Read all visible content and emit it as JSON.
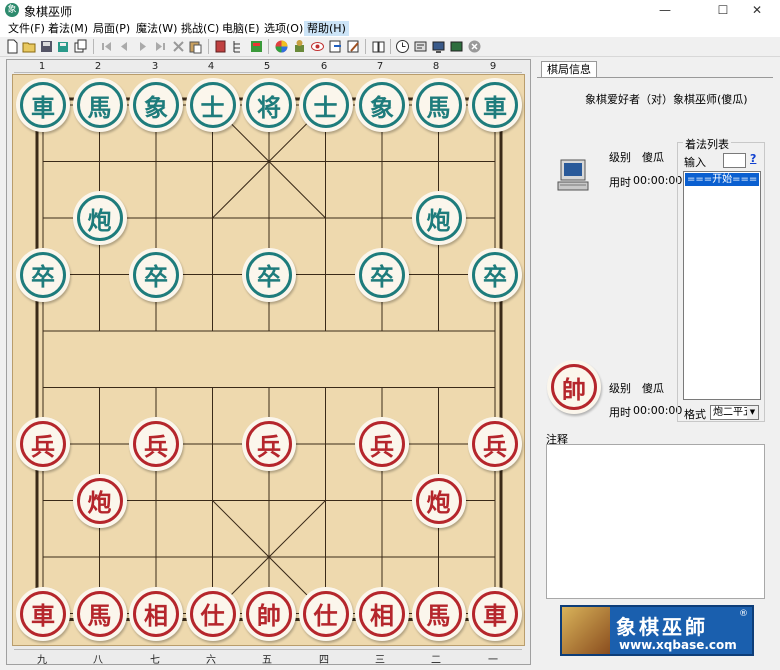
{
  "window": {
    "title": "象棋巫师",
    "app_icon_char": "象",
    "controls": [
      "—",
      "☐",
      "✕"
    ]
  },
  "menu": [
    "文件(F)",
    "着法(M)",
    "局面(P)",
    "魔法(W)",
    "挑战(C)",
    "电脑(E)",
    "选项(O)",
    "帮助(H)"
  ],
  "active_menu_index": 7,
  "toolbar_icons": [
    "new-file-icon",
    "open-folder-icon",
    "save-icon",
    "save-as-icon",
    "copy-board-icon",
    "first-move-icon",
    "prev-move-icon",
    "next-move-icon",
    "last-move-icon",
    "delete-icon",
    "paste-icon",
    "book-icon",
    "tree-icon",
    "calculator-icon",
    "color-wheel-icon",
    "engine-icon",
    "eye-icon",
    "export-icon",
    "edit-icon",
    "manual-icon",
    "clock-icon",
    "settings-icon",
    "monitor-icon",
    "screen-icon",
    "stop-icon"
  ],
  "board": {
    "file_numbers_top": [
      "1",
      "2",
      "3",
      "4",
      "5",
      "6",
      "7",
      "8",
      "9"
    ],
    "file_numbers_bottom": [
      "九",
      "八",
      "七",
      "六",
      "五",
      "四",
      "三",
      "二",
      "一"
    ],
    "colors": {
      "wood": "#eed9ae",
      "line": "#3a2a18",
      "black_piece": "#1e7c7c",
      "red_piece": "#b5262c"
    },
    "pieces": [
      {
        "side": "black",
        "char": "車",
        "file": 1,
        "rank": 1
      },
      {
        "side": "black",
        "char": "馬",
        "file": 2,
        "rank": 1
      },
      {
        "side": "black",
        "char": "象",
        "file": 3,
        "rank": 1
      },
      {
        "side": "black",
        "char": "士",
        "file": 4,
        "rank": 1
      },
      {
        "side": "black",
        "char": "将",
        "file": 5,
        "rank": 1
      },
      {
        "side": "black",
        "char": "士",
        "file": 6,
        "rank": 1
      },
      {
        "side": "black",
        "char": "象",
        "file": 7,
        "rank": 1
      },
      {
        "side": "black",
        "char": "馬",
        "file": 8,
        "rank": 1
      },
      {
        "side": "black",
        "char": "車",
        "file": 9,
        "rank": 1
      },
      {
        "side": "black",
        "char": "炮",
        "file": 2,
        "rank": 3
      },
      {
        "side": "black",
        "char": "炮",
        "file": 8,
        "rank": 3
      },
      {
        "side": "black",
        "char": "卒",
        "file": 1,
        "rank": 4
      },
      {
        "side": "black",
        "char": "卒",
        "file": 3,
        "rank": 4
      },
      {
        "side": "black",
        "char": "卒",
        "file": 5,
        "rank": 4
      },
      {
        "side": "black",
        "char": "卒",
        "file": 7,
        "rank": 4
      },
      {
        "side": "black",
        "char": "卒",
        "file": 9,
        "rank": 4
      },
      {
        "side": "red",
        "char": "兵",
        "file": 1,
        "rank": 7
      },
      {
        "side": "red",
        "char": "兵",
        "file": 3,
        "rank": 7
      },
      {
        "side": "red",
        "char": "兵",
        "file": 5,
        "rank": 7
      },
      {
        "side": "red",
        "char": "兵",
        "file": 7,
        "rank": 7
      },
      {
        "side": "red",
        "char": "兵",
        "file": 9,
        "rank": 7
      },
      {
        "side": "red",
        "char": "炮",
        "file": 2,
        "rank": 8
      },
      {
        "side": "red",
        "char": "炮",
        "file": 8,
        "rank": 8
      },
      {
        "side": "red",
        "char": "車",
        "file": 1,
        "rank": 10
      },
      {
        "side": "red",
        "char": "馬",
        "file": 2,
        "rank": 10
      },
      {
        "side": "red",
        "char": "相",
        "file": 3,
        "rank": 10
      },
      {
        "side": "red",
        "char": "仕",
        "file": 4,
        "rank": 10
      },
      {
        "side": "red",
        "char": "帥",
        "file": 5,
        "rank": 10
      },
      {
        "side": "red",
        "char": "仕",
        "file": 6,
        "rank": 10
      },
      {
        "side": "red",
        "char": "相",
        "file": 7,
        "rank": 10
      },
      {
        "side": "red",
        "char": "馬",
        "file": 8,
        "rank": 10
      },
      {
        "side": "red",
        "char": "車",
        "file": 9,
        "rank": 10
      }
    ]
  },
  "panel": {
    "tab_label": "棋局信息",
    "matchup": "象棋爱好者（对）象棋巫师(傻瓜)",
    "top_player": {
      "level_label": "级别",
      "level_value": "傻瓜",
      "time_label": "用时",
      "time_value": "00:00:00"
    },
    "bottom_player": {
      "level_label": "级别",
      "level_value": "傻瓜",
      "time_label": "用时",
      "time_value": "00:00:00",
      "avatar_char": "帥"
    },
    "move_list": {
      "legend": "着法列表",
      "input_label": "输入",
      "input_value": "",
      "help_text": "?",
      "items": [
        "===开始==="
      ],
      "format_label": "格式",
      "format_value": "炮二平五"
    },
    "notes_label": "注释",
    "notes_value": ""
  },
  "logo": {
    "title": "象棋巫師",
    "url": "www.xqbase.com",
    "reg": "®"
  }
}
